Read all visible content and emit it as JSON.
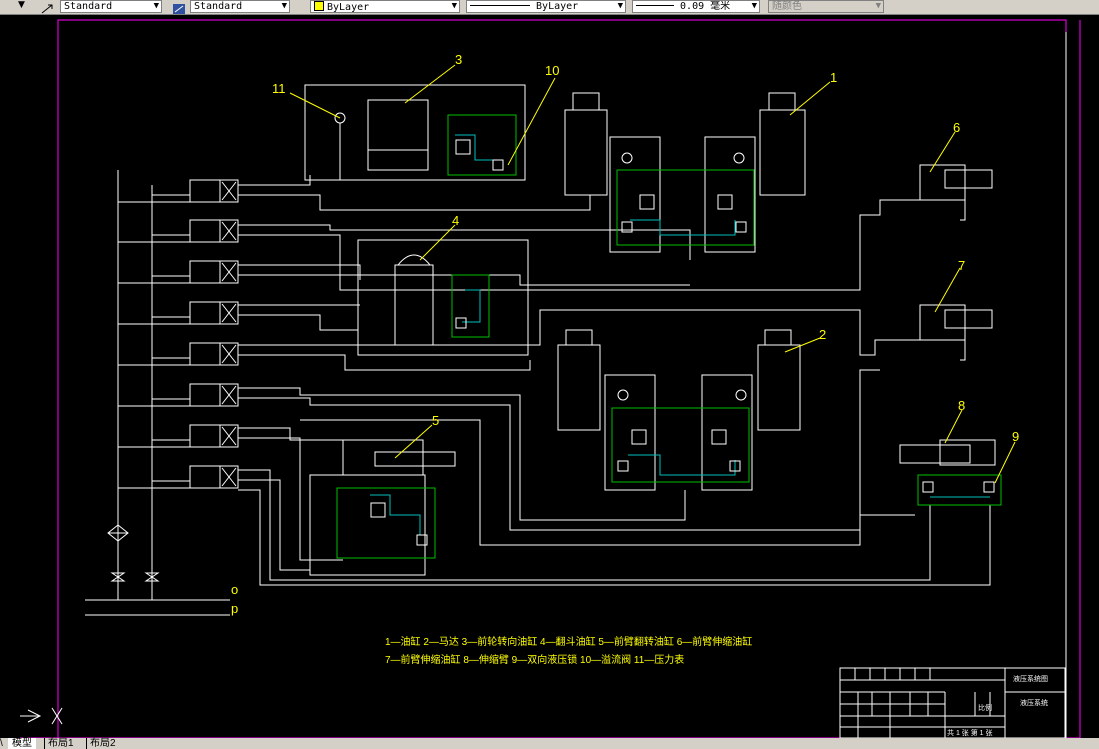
{
  "toolbar": {
    "text_style": "Standard",
    "dim_style": "Standard",
    "layer": "ByLayer",
    "linetype": "ByLayer",
    "lineweight": "0.09 毫米",
    "plot_style": "随颜色"
  },
  "drawing": {
    "labels": {
      "n1": "1",
      "n2": "2",
      "n3": "3",
      "n4": "4",
      "n5": "5",
      "n6": "6",
      "n7": "7",
      "n8": "8",
      "n9": "9",
      "n10": "10",
      "n11": "11",
      "o": "o",
      "p": "p"
    },
    "legend_line1": "1—油缸  2—马达  3—前轮转向油缸  4—翻斗油缸  5—前臂翻转油缸  6—前臂伸缩油缸",
    "legend_line2": "7—前臂伸缩油缸  8—伸缩臂  9—双向液压锁  10—溢流阀  11—压力表"
  },
  "title_block": {
    "title": "液压系统图",
    "drawing_name": "液压系统",
    "scale_label": "比例",
    "sheet_info": "共 1 张  第 1 张"
  },
  "tabs": [
    {
      "label": "模型",
      "active": true
    },
    {
      "label": "布局1",
      "active": false
    },
    {
      "label": "布局2",
      "active": false
    }
  ],
  "colors": {
    "background": "#000000",
    "lines": "#ffffff",
    "border": "#ff00ff",
    "accent_green": "#00c000",
    "accent_cyan": "#00c0c0",
    "labels": "#ffff00"
  }
}
